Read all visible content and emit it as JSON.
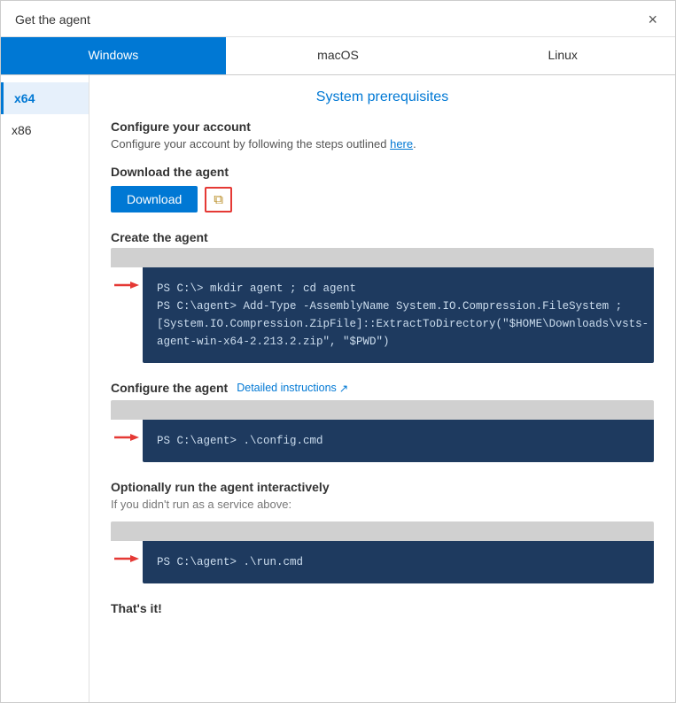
{
  "dialog": {
    "title": "Get the agent",
    "close_label": "×"
  },
  "tabs": [
    {
      "id": "windows",
      "label": "Windows",
      "active": true
    },
    {
      "id": "macos",
      "label": "macOS",
      "active": false
    },
    {
      "id": "linux",
      "label": "Linux",
      "active": false
    }
  ],
  "sidebar": {
    "items": [
      {
        "id": "x64",
        "label": "x64",
        "active": true
      },
      {
        "id": "x86",
        "label": "x86",
        "active": false
      }
    ]
  },
  "content": {
    "section_title": "System prerequisites",
    "configure_account_heading": "Configure your account",
    "configure_account_text": "Configure your account by following the steps outlined",
    "configure_account_link": "here",
    "download_agent_heading": "Download the agent",
    "download_button_label": "Download",
    "copy_icon": "⧉",
    "create_agent_heading": "Create the agent",
    "create_agent_code": "PS C:\\> mkdir agent ; cd agent\nPS C:\\agent> Add-Type -AssemblyName System.IO.Compression.FileSystem ;\n[System.IO.Compression.ZipFile]::ExtractToDirectory(\"$HOME\\Downloads\\vsts-\nagent-win-x64-2.213.2.zip\", \"$PWD\")",
    "configure_agent_heading": "Configure the agent",
    "detailed_instructions_label": "Detailed instructions",
    "detailed_instructions_icon": "↗",
    "configure_agent_code": "PS C:\\agent> .\\config.cmd",
    "optional_heading": "Optionally run the agent interactively",
    "optional_text": "If you didn't run as a service above:",
    "run_agent_code": "PS C:\\agent> .\\run.cmd",
    "thats_it": "That's it!"
  }
}
